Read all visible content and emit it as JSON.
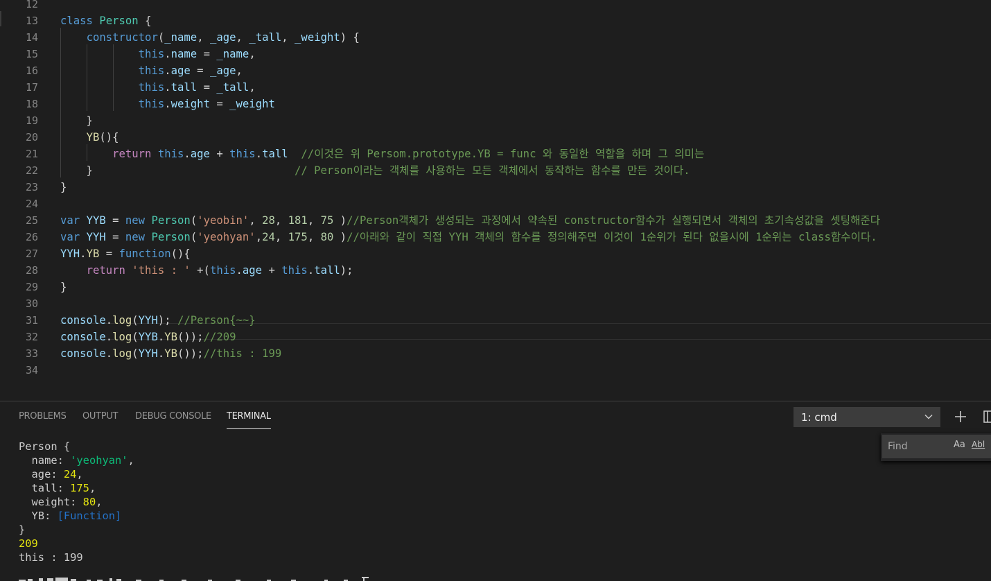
{
  "editor": {
    "lines": [
      {
        "n": "12",
        "tokens": []
      },
      {
        "n": "13",
        "tokens": [
          {
            "t": "class ",
            "c": "k"
          },
          {
            "t": "Person",
            "c": "cls"
          },
          {
            "t": " {",
            "c": "p"
          }
        ]
      },
      {
        "n": "14",
        "tokens": [
          {
            "t": "    ",
            "c": "p"
          },
          {
            "t": "constructor",
            "c": "k"
          },
          {
            "t": "(",
            "c": "p"
          },
          {
            "t": "_name",
            "c": "v"
          },
          {
            "t": ", ",
            "c": "p"
          },
          {
            "t": "_age",
            "c": "v"
          },
          {
            "t": ", ",
            "c": "p"
          },
          {
            "t": "_tall",
            "c": "v"
          },
          {
            "t": ", ",
            "c": "p"
          },
          {
            "t": "_weight",
            "c": "v"
          },
          {
            "t": ") {",
            "c": "p"
          }
        ]
      },
      {
        "n": "15",
        "tokens": [
          {
            "t": "            ",
            "c": "p"
          },
          {
            "t": "this",
            "c": "k"
          },
          {
            "t": ".",
            "c": "p"
          },
          {
            "t": "name",
            "c": "v"
          },
          {
            "t": " = ",
            "c": "p"
          },
          {
            "t": "_name",
            "c": "v"
          },
          {
            "t": ",",
            "c": "p"
          }
        ]
      },
      {
        "n": "16",
        "tokens": [
          {
            "t": "            ",
            "c": "p"
          },
          {
            "t": "this",
            "c": "k"
          },
          {
            "t": ".",
            "c": "p"
          },
          {
            "t": "age",
            "c": "v"
          },
          {
            "t": " = ",
            "c": "p"
          },
          {
            "t": "_age",
            "c": "v"
          },
          {
            "t": ",",
            "c": "p"
          }
        ]
      },
      {
        "n": "17",
        "tokens": [
          {
            "t": "            ",
            "c": "p"
          },
          {
            "t": "this",
            "c": "k"
          },
          {
            "t": ".",
            "c": "p"
          },
          {
            "t": "tall",
            "c": "v"
          },
          {
            "t": " = ",
            "c": "p"
          },
          {
            "t": "_tall",
            "c": "v"
          },
          {
            "t": ",",
            "c": "p"
          }
        ]
      },
      {
        "n": "18",
        "tokens": [
          {
            "t": "            ",
            "c": "p"
          },
          {
            "t": "this",
            "c": "k"
          },
          {
            "t": ".",
            "c": "p"
          },
          {
            "t": "weight",
            "c": "v"
          },
          {
            "t": " = ",
            "c": "p"
          },
          {
            "t": "_weight",
            "c": "v"
          }
        ]
      },
      {
        "n": "19",
        "tokens": [
          {
            "t": "    }",
            "c": "p"
          }
        ]
      },
      {
        "n": "20",
        "tokens": [
          {
            "t": "    ",
            "c": "p"
          },
          {
            "t": "YB",
            "c": "fn"
          },
          {
            "t": "(){",
            "c": "p"
          }
        ]
      },
      {
        "n": "21",
        "tokens": [
          {
            "t": "        ",
            "c": "p"
          },
          {
            "t": "return ",
            "c": "ctl"
          },
          {
            "t": "this",
            "c": "k"
          },
          {
            "t": ".",
            "c": "p"
          },
          {
            "t": "age",
            "c": "v"
          },
          {
            "t": " + ",
            "c": "p"
          },
          {
            "t": "this",
            "c": "k"
          },
          {
            "t": ".",
            "c": "p"
          },
          {
            "t": "tall",
            "c": "v"
          },
          {
            "t": "  ",
            "c": "p"
          },
          {
            "t": "//이것은 위 Persom.prototype.YB = func 와 동일한 역할을 하며 그 의미는",
            "c": "c"
          }
        ]
      },
      {
        "n": "22",
        "tokens": [
          {
            "t": "    }                               ",
            "c": "p"
          },
          {
            "t": "// Person이라는 객체를 사용하는 모든 객체에서 동작하는 함수를 만든 것이다.",
            "c": "c"
          }
        ]
      },
      {
        "n": "23",
        "tokens": [
          {
            "t": "}",
            "c": "p"
          }
        ]
      },
      {
        "n": "24",
        "tokens": []
      },
      {
        "n": "25",
        "tokens": [
          {
            "t": "var ",
            "c": "k"
          },
          {
            "t": "YYB",
            "c": "v"
          },
          {
            "t": " = ",
            "c": "p"
          },
          {
            "t": "new ",
            "c": "k"
          },
          {
            "t": "Person",
            "c": "cls"
          },
          {
            "t": "(",
            "c": "p"
          },
          {
            "t": "'yeobin'",
            "c": "s"
          },
          {
            "t": ", ",
            "c": "p"
          },
          {
            "t": "28",
            "c": "n"
          },
          {
            "t": ", ",
            "c": "p"
          },
          {
            "t": "181",
            "c": "n"
          },
          {
            "t": ", ",
            "c": "p"
          },
          {
            "t": "75",
            "c": "n"
          },
          {
            "t": " )",
            "c": "p"
          },
          {
            "t": "//Person객체가 생성되는 과정에서 약속된 constructor함수가 실행되면서 객체의 초기속성값을 셋팅해준다",
            "c": "c"
          }
        ]
      },
      {
        "n": "26",
        "tokens": [
          {
            "t": "var ",
            "c": "k"
          },
          {
            "t": "YYH",
            "c": "v"
          },
          {
            "t": " = ",
            "c": "p"
          },
          {
            "t": "new ",
            "c": "k"
          },
          {
            "t": "Person",
            "c": "cls"
          },
          {
            "t": "(",
            "c": "p"
          },
          {
            "t": "'yeohyan'",
            "c": "s"
          },
          {
            "t": ",",
            "c": "p"
          },
          {
            "t": "24",
            "c": "n"
          },
          {
            "t": ", ",
            "c": "p"
          },
          {
            "t": "175",
            "c": "n"
          },
          {
            "t": ", ",
            "c": "p"
          },
          {
            "t": "80",
            "c": "n"
          },
          {
            "t": " )",
            "c": "p"
          },
          {
            "t": "//아래와 같이 직접 YYH 객체의 함수를 정의해주면 이것이 1순위가 된다 없을시에 1순위는 class함수이다.",
            "c": "c"
          }
        ]
      },
      {
        "n": "27",
        "tokens": [
          {
            "t": "YYH",
            "c": "v"
          },
          {
            "t": ".",
            "c": "p"
          },
          {
            "t": "YB",
            "c": "fn"
          },
          {
            "t": " = ",
            "c": "p"
          },
          {
            "t": "function",
            "c": "k"
          },
          {
            "t": "(){",
            "c": "p"
          }
        ]
      },
      {
        "n": "28",
        "tokens": [
          {
            "t": "    ",
            "c": "p"
          },
          {
            "t": "return ",
            "c": "ctl"
          },
          {
            "t": "'this : '",
            "c": "s"
          },
          {
            "t": " +(",
            "c": "p"
          },
          {
            "t": "this",
            "c": "k"
          },
          {
            "t": ".",
            "c": "p"
          },
          {
            "t": "age",
            "c": "v"
          },
          {
            "t": " + ",
            "c": "p"
          },
          {
            "t": "this",
            "c": "k"
          },
          {
            "t": ".",
            "c": "p"
          },
          {
            "t": "tall",
            "c": "v"
          },
          {
            "t": ");",
            "c": "p"
          }
        ]
      },
      {
        "n": "29",
        "tokens": [
          {
            "t": "}",
            "c": "p"
          }
        ]
      },
      {
        "n": "30",
        "tokens": []
      },
      {
        "n": "31",
        "tokens": [
          {
            "t": "console",
            "c": "v"
          },
          {
            "t": ".",
            "c": "p"
          },
          {
            "t": "log",
            "c": "fn"
          },
          {
            "t": "(",
            "c": "p"
          },
          {
            "t": "YYH",
            "c": "v"
          },
          {
            "t": "); ",
            "c": "p"
          },
          {
            "t": "//Person{~~}",
            "c": "c"
          }
        ]
      },
      {
        "n": "32",
        "tokens": [
          {
            "t": "console",
            "c": "v"
          },
          {
            "t": ".",
            "c": "p"
          },
          {
            "t": "log",
            "c": "fn"
          },
          {
            "t": "(",
            "c": "p"
          },
          {
            "t": "YYB",
            "c": "v"
          },
          {
            "t": ".",
            "c": "p"
          },
          {
            "t": "YB",
            "c": "fn"
          },
          {
            "t": "());",
            "c": "p"
          },
          {
            "t": "//209",
            "c": "c"
          }
        ]
      },
      {
        "n": "33",
        "tokens": [
          {
            "t": "console",
            "c": "v"
          },
          {
            "t": ".",
            "c": "p"
          },
          {
            "t": "log",
            "c": "fn"
          },
          {
            "t": "(",
            "c": "p"
          },
          {
            "t": "YYH",
            "c": "v"
          },
          {
            "t": ".",
            "c": "p"
          },
          {
            "t": "YB",
            "c": "fn"
          },
          {
            "t": "());",
            "c": "p"
          },
          {
            "t": "//this : 199",
            "c": "c"
          }
        ]
      },
      {
        "n": "34",
        "tokens": []
      }
    ]
  },
  "panel": {
    "tabs": {
      "problems": "PROBLEMS",
      "output": "OUTPUT",
      "debug_console": "DEBUG CONSOLE",
      "terminal": "TERMINAL"
    },
    "active_tab": "terminal",
    "terminal_select": "1: cmd",
    "find_placeholder": "Find",
    "match_case_label": "Aa",
    "match_word_label": "Abl"
  },
  "terminal": {
    "lines": [
      [
        {
          "t": "Person {",
          "c": ""
        }
      ],
      [
        {
          "t": "  name: ",
          "c": ""
        },
        {
          "t": "'yeohyan'",
          "c": "tg"
        },
        {
          "t": ",",
          "c": ""
        }
      ],
      [
        {
          "t": "  age: ",
          "c": ""
        },
        {
          "t": "24",
          "c": "ty"
        },
        {
          "t": ",",
          "c": ""
        }
      ],
      [
        {
          "t": "  tall: ",
          "c": ""
        },
        {
          "t": "175",
          "c": "ty"
        },
        {
          "t": ",",
          "c": ""
        }
      ],
      [
        {
          "t": "  weight: ",
          "c": ""
        },
        {
          "t": "80",
          "c": "ty"
        },
        {
          "t": ",",
          "c": ""
        }
      ],
      [
        {
          "t": "  YB: ",
          "c": ""
        },
        {
          "t": "[Function]",
          "c": "tb"
        }
      ],
      [
        {
          "t": "}",
          "c": ""
        }
      ],
      [
        {
          "t": "209",
          "c": "ty"
        }
      ],
      [
        {
          "t": "this : 199",
          "c": ""
        }
      ]
    ]
  },
  "icons": {
    "chevron": "chevron-down-icon",
    "plus": "plus-icon",
    "split": "split-terminal-icon"
  }
}
